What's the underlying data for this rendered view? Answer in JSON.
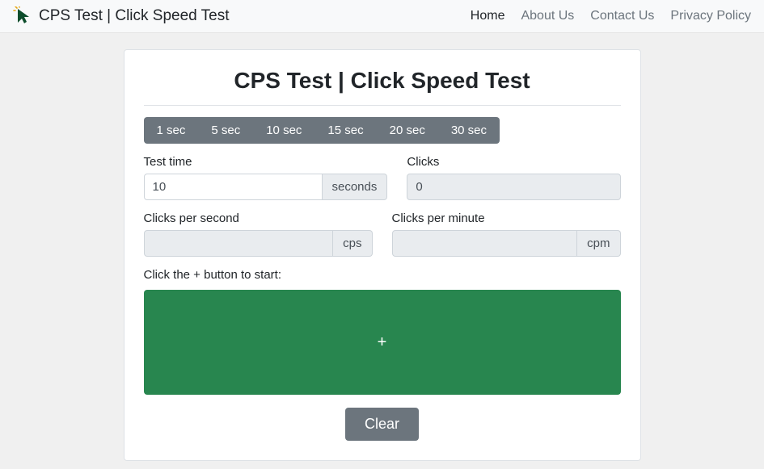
{
  "header": {
    "brand_text": "CPS Test | Click Speed Test",
    "nav": {
      "home": "Home",
      "about": "About Us",
      "contact": "Contact Us",
      "privacy": "Privacy Policy"
    }
  },
  "page": {
    "title": "CPS Test | Click Speed Test"
  },
  "durations": [
    {
      "label": "1 sec"
    },
    {
      "label": "5 sec"
    },
    {
      "label": "10 sec"
    },
    {
      "label": "15 sec"
    },
    {
      "label": "20 sec"
    },
    {
      "label": "30 sec"
    }
  ],
  "fields": {
    "test_time": {
      "label": "Test time",
      "value": "10",
      "unit": "seconds"
    },
    "clicks": {
      "label": "Clicks",
      "value": "0"
    },
    "cps": {
      "label": "Clicks per second",
      "value": "",
      "unit": "cps"
    },
    "cpm": {
      "label": "Clicks per minute",
      "value": "",
      "unit": "cpm"
    }
  },
  "instruction": "Click the + button to start:",
  "click_button": "+",
  "clear_button": "Clear"
}
